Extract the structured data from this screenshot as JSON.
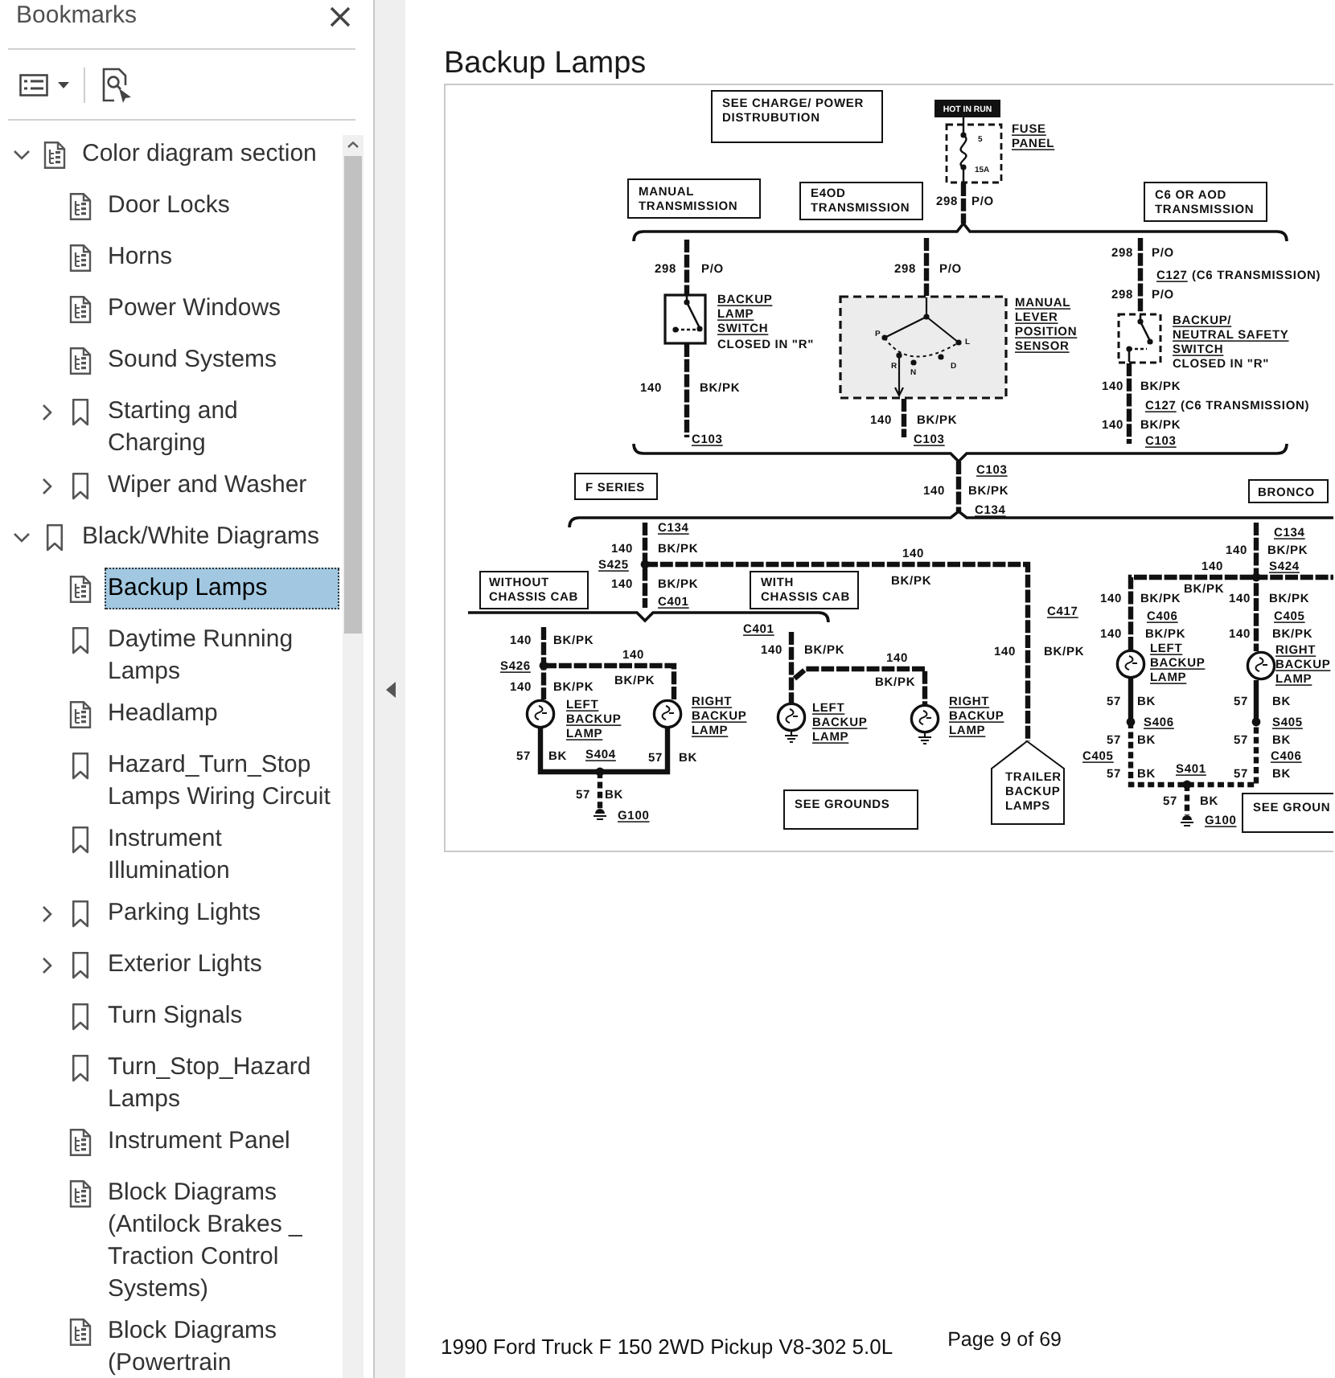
{
  "sidebar": {
    "title": "Bookmarks",
    "items": [
      {
        "label": "Color diagram section",
        "kind": "page",
        "expanded": true,
        "selected": false,
        "children": [
          {
            "label": "Door Locks",
            "kind": "page",
            "selected": false
          },
          {
            "label": "Horns",
            "kind": "page",
            "selected": false
          },
          {
            "label": "Power Windows",
            "kind": "page",
            "selected": false
          },
          {
            "label": "Sound Systems",
            "kind": "page",
            "selected": false
          },
          {
            "label": "Starting and Charging",
            "kind": "bookmark",
            "expanded": false,
            "selected": false
          },
          {
            "label": "Wiper and Washer",
            "kind": "bookmark",
            "expanded": false,
            "selected": false
          }
        ]
      },
      {
        "label": "Black/White Diagrams",
        "kind": "bookmark",
        "expanded": true,
        "selected": false,
        "children": [
          {
            "label": "Backup Lamps",
            "kind": "page",
            "selected": true
          },
          {
            "label": "Daytime Running Lamps",
            "kind": "bookmark",
            "selected": false
          },
          {
            "label": "Headlamp",
            "kind": "page",
            "selected": false
          },
          {
            "label": "Hazard_Turn_Stop Lamps Wiring Circuit",
            "kind": "bookmark",
            "selected": false
          },
          {
            "label": "Instrument Illumination",
            "kind": "bookmark",
            "selected": false
          },
          {
            "label": "Parking Lights",
            "kind": "bookmark",
            "expanded": false,
            "selected": false
          },
          {
            "label": "Exterior Lights",
            "kind": "bookmark",
            "expanded": false,
            "selected": false
          },
          {
            "label": "Turn Signals",
            "kind": "bookmark",
            "selected": false
          },
          {
            "label": "Turn_Stop_Hazard Lamps",
            "kind": "bookmark",
            "selected": false
          },
          {
            "label": "Instrument Panel",
            "kind": "page",
            "selected": false
          },
          {
            "label": "Block Diagrams (Antilock Brakes _ Traction Control Systems)",
            "kind": "page",
            "selected": false
          },
          {
            "label": "Block Diagrams (Powertrain",
            "kind": "page",
            "selected": false
          }
        ]
      }
    ]
  },
  "document": {
    "title": "Backup Lamps",
    "diagram": {
      "labels": [
        {
          "kind": "box",
          "text": "SEE CHARGE/ POWER\nDISTRUBUTION"
        },
        {
          "kind": "tag",
          "text": "HOT IN RUN"
        },
        {
          "kind": "tiny",
          "text": "5"
        },
        {
          "kind": "ref",
          "text": "FUSE\nPANEL"
        },
        {
          "kind": "tiny",
          "text": "15A"
        },
        {
          "kind": "box",
          "text": "MANUAL\nTRANSMISSION"
        },
        {
          "kind": "box",
          "text": "E4OD\nTRANSMISSION"
        },
        {
          "kind": "label",
          "text": "298"
        },
        {
          "kind": "label",
          "text": "P/O"
        },
        {
          "kind": "box",
          "text": "C6 OR AOD\nTRANSMISSION"
        },
        {
          "kind": "label",
          "text": "298"
        },
        {
          "kind": "label",
          "text": "P/O"
        },
        {
          "kind": "label",
          "text": "298"
        },
        {
          "kind": "label",
          "text": "P/O"
        },
        {
          "kind": "label",
          "text": "298"
        },
        {
          "kind": "label",
          "text": "P/O"
        },
        {
          "kind": "ref",
          "text": "C127"
        },
        {
          "kind": "label",
          "text": "(C6 TRANSMISSION)"
        },
        {
          "kind": "ref",
          "text": "BACKUP\nLAMP\nSWITCH"
        },
        {
          "kind": "label",
          "text": "CLOSED IN \"R\""
        },
        {
          "kind": "tiny",
          "text": "P"
        },
        {
          "kind": "tiny",
          "text": "L"
        },
        {
          "kind": "ref",
          "text": "MANUAL\nLEVER\nPOSITION\nSENSOR"
        },
        {
          "kind": "label",
          "text": "298"
        },
        {
          "kind": "label",
          "text": "P/O"
        },
        {
          "kind": "ref",
          "text": "BACKUP/\nNEUTRAL SAFETY\nSWITCH"
        },
        {
          "kind": "tiny",
          "text": "R"
        },
        {
          "kind": "tiny",
          "text": "N"
        },
        {
          "kind": "tiny",
          "text": "D"
        },
        {
          "kind": "label",
          "text": "CLOSED IN \"R\""
        },
        {
          "kind": "label",
          "text": "140"
        },
        {
          "kind": "label",
          "text": "BK/PK"
        },
        {
          "kind": "label",
          "text": "140"
        },
        {
          "kind": "label",
          "text": "BK/PK"
        },
        {
          "kind": "ref",
          "text": "C127"
        },
        {
          "kind": "label",
          "text": "(C6 TRANSMISSION)"
        },
        {
          "kind": "label",
          "text": "140"
        },
        {
          "kind": "label",
          "text": "BK/PK"
        },
        {
          "kind": "label",
          "text": "140"
        },
        {
          "kind": "label",
          "text": "BK/PK"
        },
        {
          "kind": "ref",
          "text": "C103"
        },
        {
          "kind": "ref",
          "text": "C103"
        },
        {
          "kind": "ref",
          "text": "C103"
        },
        {
          "kind": "box",
          "text": "F SERIES"
        },
        {
          "kind": "ref",
          "text": "C103"
        },
        {
          "kind": "label",
          "text": "140"
        },
        {
          "kind": "label",
          "text": "BK/PK"
        },
        {
          "kind": "box",
          "text": "BRONCO"
        },
        {
          "kind": "ref",
          "text": "C134"
        },
        {
          "kind": "ref",
          "text": "C134"
        },
        {
          "kind": "ref",
          "text": "C134"
        },
        {
          "kind": "label",
          "text": "140"
        },
        {
          "kind": "label",
          "text": "BK/PK"
        },
        {
          "kind": "label",
          "text": "140"
        },
        {
          "kind": "label",
          "text": "140"
        },
        {
          "kind": "label",
          "text": "BK/PK"
        },
        {
          "kind": "ref",
          "text": "S425"
        },
        {
          "kind": "label",
          "text": "140"
        },
        {
          "kind": "ref",
          "text": "S424"
        },
        {
          "kind": "box",
          "text": "WITHOUT\nCHASSIS CAB"
        },
        {
          "kind": "label",
          "text": "140"
        },
        {
          "kind": "label",
          "text": "BK/PK"
        },
        {
          "kind": "ref",
          "text": "C401"
        },
        {
          "kind": "box",
          "text": "WITH\nCHASSIS CAB"
        },
        {
          "kind": "label",
          "text": "BK/PK"
        },
        {
          "kind": "label",
          "text": "140"
        },
        {
          "kind": "label",
          "text": "BK/PK"
        },
        {
          "kind": "label",
          "text": "BK/PK"
        },
        {
          "kind": "label",
          "text": "140"
        },
        {
          "kind": "label",
          "text": "BK/PK"
        },
        {
          "kind": "ref",
          "text": "C417"
        },
        {
          "kind": "ref",
          "text": "C406"
        },
        {
          "kind": "ref",
          "text": "C405"
        },
        {
          "kind": "ref",
          "text": "C401"
        },
        {
          "kind": "label",
          "text": "140"
        },
        {
          "kind": "label",
          "text": "BK/PK"
        },
        {
          "kind": "label",
          "text": "140"
        },
        {
          "kind": "label",
          "text": "BK/PK"
        },
        {
          "kind": "label",
          "text": "140"
        },
        {
          "kind": "label",
          "text": "BK/PK"
        },
        {
          "kind": "ref",
          "text": "S426"
        },
        {
          "kind": "label",
          "text": "140"
        },
        {
          "kind": "label",
          "text": "140"
        },
        {
          "kind": "label",
          "text": "BK/PK"
        },
        {
          "kind": "label",
          "text": "140"
        },
        {
          "kind": "label",
          "text": "140"
        },
        {
          "kind": "label",
          "text": "BK/PK"
        },
        {
          "kind": "label",
          "text": "140"
        },
        {
          "kind": "label",
          "text": "BK/PK"
        },
        {
          "kind": "label",
          "text": "BK/PK"
        },
        {
          "kind": "label",
          "text": "BK/PK"
        },
        {
          "kind": "ref",
          "text": "LEFT\nBACKUP\nLAMP"
        },
        {
          "kind": "ref",
          "text": "RIGHT\nBACKUP\nLAMP"
        },
        {
          "kind": "ref",
          "text": "LEFT\nBACKUP\nLAMP"
        },
        {
          "kind": "ref",
          "text": "RIGHT\nBACKUP\nLAMP"
        },
        {
          "kind": "ref",
          "text": "LEFT\nBACKUP\nLAMP"
        },
        {
          "kind": "ref",
          "text": "RIGHT\nBACKUP\nLAMP"
        },
        {
          "kind": "label",
          "text": "57"
        },
        {
          "kind": "label",
          "text": "BK"
        },
        {
          "kind": "label",
          "text": "57"
        },
        {
          "kind": "label",
          "text": "BK"
        },
        {
          "kind": "ref",
          "text": "S406"
        },
        {
          "kind": "ref",
          "text": "S405"
        },
        {
          "kind": "label",
          "text": "57"
        },
        {
          "kind": "label",
          "text": "BK"
        },
        {
          "kind": "ref",
          "text": "S404"
        },
        {
          "kind": "label",
          "text": "57"
        },
        {
          "kind": "label",
          "text": "BK"
        },
        {
          "kind": "label",
          "text": "57"
        },
        {
          "kind": "label",
          "text": "BK"
        },
        {
          "kind": "box",
          "text": "SEE GROUNDS"
        },
        {
          "kind": "ref",
          "text": "G100"
        },
        {
          "kind": "pointer",
          "text": "TRAILER\nBACKUP\nLAMPS"
        },
        {
          "kind": "label",
          "text": "57"
        },
        {
          "kind": "label",
          "text": "BK"
        },
        {
          "kind": "label",
          "text": "57"
        },
        {
          "kind": "label",
          "text": "BK"
        },
        {
          "kind": "ref",
          "text": "C405"
        },
        {
          "kind": "ref",
          "text": "C406"
        },
        {
          "kind": "label",
          "text": "57"
        },
        {
          "kind": "label",
          "text": "BK"
        },
        {
          "kind": "ref",
          "text": "S401"
        },
        {
          "kind": "label",
          "text": "57"
        },
        {
          "kind": "label",
          "text": "BK"
        },
        {
          "kind": "label",
          "text": "57"
        },
        {
          "kind": "label",
          "text": "BK"
        },
        {
          "kind": "box",
          "text": "SEE GROUN"
        },
        {
          "kind": "ref",
          "text": "G100"
        }
      ]
    },
    "footer": {
      "caption": "1990 Ford Truck F 150 2WD Pickup V8-302 5.0L",
      "page": "Page 9 of 69"
    }
  }
}
